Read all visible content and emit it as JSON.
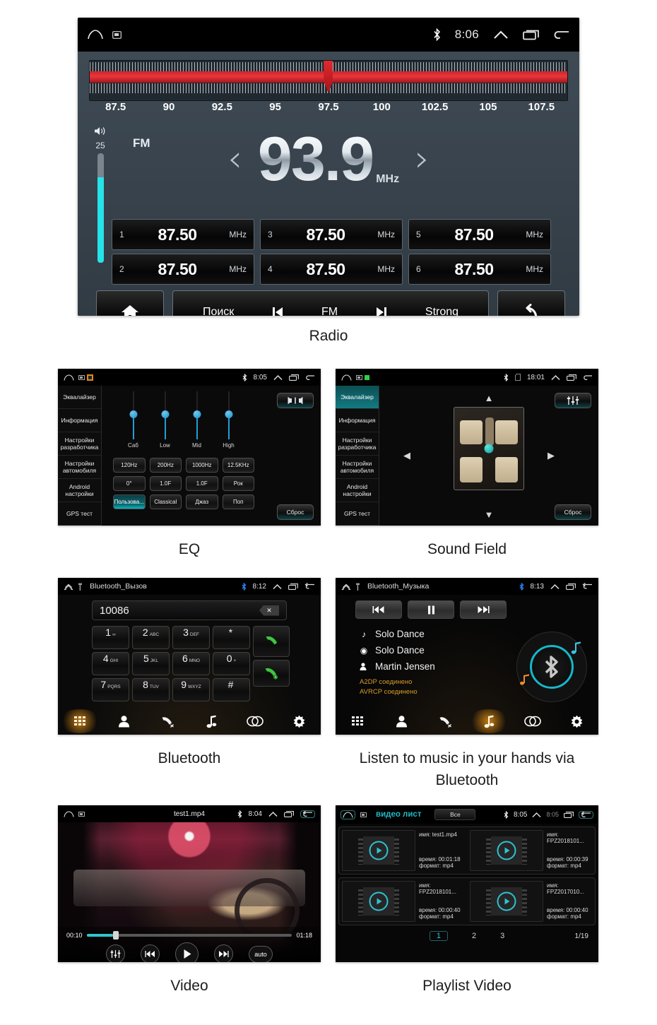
{
  "captions": {
    "radio": "Radio",
    "eq": "EQ",
    "sound_field": "Sound Field",
    "bluetooth": "Bluetooth",
    "bt_music": "Listen to music in your hands via Bluetooth",
    "video": "Video",
    "playlist": "Playlist Video"
  },
  "radio": {
    "statusbar": {
      "time": "8:06",
      "bluetooth_icon": "bluetooth-icon",
      "home_icon": "home-icon",
      "screen_icon": "screen-icon",
      "up_icon": "chevron-up-icon",
      "recents_icon": "recents-icon",
      "back_icon": "back-icon"
    },
    "tuner": {
      "scale_labels": [
        "87.5",
        "90",
        "92.5",
        "95",
        "97.5",
        "100",
        "102.5",
        "105",
        "107.5"
      ],
      "needle_percent": 49,
      "band_color": "#d2252b"
    },
    "volume": {
      "value": "25",
      "level_percent": 78,
      "fill_color": "#25e3e8",
      "icon": "volume-icon"
    },
    "band": "FM",
    "frequency": "93.9",
    "frequency_unit": "MHz",
    "prev_icon": "chevron-left-icon",
    "next_icon": "chevron-right-icon",
    "presets": [
      {
        "index": "1",
        "value": "87.50",
        "unit": "MHz"
      },
      {
        "index": "3",
        "value": "87.50",
        "unit": "MHz"
      },
      {
        "index": "5",
        "value": "87.50",
        "unit": "MHz"
      },
      {
        "index": "2",
        "value": "87.50",
        "unit": "MHz"
      },
      {
        "index": "4",
        "value": "87.50",
        "unit": "MHz"
      },
      {
        "index": "6",
        "value": "87.50",
        "unit": "MHz"
      }
    ],
    "bottom": {
      "home_icon": "home-icon",
      "search_label": "Поиск",
      "prev_icon": "skip-previous-icon",
      "band_label": "FM",
      "next_icon": "skip-next-icon",
      "strong_label": "Strong",
      "back_icon": "back-arrow-icon"
    }
  },
  "eq": {
    "statusbar": {
      "time": "8:05"
    },
    "sidebar": [
      "Эквалайзер",
      "Информация",
      "Настройки разработчика",
      "Настройки автомобиля",
      "Android настройки",
      "GPS тест"
    ],
    "sidebar_active_index": -1,
    "sliders": [
      {
        "label": "Саб",
        "position_percent": 50
      },
      {
        "label": "Low",
        "position_percent": 50
      },
      {
        "label": "Mid",
        "position_percent": 50
      },
      {
        "label": "High",
        "position_percent": 50
      }
    ],
    "buttons_row1": [
      "120Hz",
      "200Hz",
      "1000Hz",
      "12.5KHz"
    ],
    "buttons_row2": [
      "0°",
      "1.0F",
      "1.0F",
      "Рок"
    ],
    "buttons_row3": [
      "Пользова...",
      "Classical",
      "Джаз",
      "Поп"
    ],
    "active_preset": "Пользова...",
    "balance_icon": "speaker-balance-icon",
    "reset_label": "Сброс"
  },
  "sound_field": {
    "statusbar": {
      "time": "18:01"
    },
    "sidebar": [
      "Эквалайзер",
      "Информация",
      "Настройки разработчика",
      "Настройки автомобиля",
      "Android настройки",
      "GPS тест"
    ],
    "sidebar_active_index": 0,
    "eq_icon": "equalizer-sliders-icon",
    "reset_label": "Сброс",
    "arrows": {
      "up": "arrow-up-icon",
      "down": "arrow-down-icon",
      "left": "arrow-left-icon",
      "right": "arrow-right-icon"
    },
    "focus_dot_color": "#0b9c9c"
  },
  "bluetooth": {
    "statusbar": {
      "title": "Bluetooth_Вызов",
      "time": "8:12"
    },
    "dial_number": "10086",
    "backspace_icon": "backspace-icon",
    "keys": [
      {
        "big": "1",
        "sml": "∞"
      },
      {
        "big": "2",
        "sml": "ABC"
      },
      {
        "big": "3",
        "sml": "DEF"
      },
      {
        "big": "*",
        "sml": ""
      },
      {
        "big": "4",
        "sml": "GHI"
      },
      {
        "big": "5",
        "sml": "JKL"
      },
      {
        "big": "6",
        "sml": "MNO"
      },
      {
        "big": "0",
        "sml": "+"
      },
      {
        "big": "7",
        "sml": "PQRS"
      },
      {
        "big": "8",
        "sml": "TUV"
      },
      {
        "big": "9",
        "sml": "WXYZ"
      },
      {
        "big": "#",
        "sml": ""
      }
    ],
    "call_icon": "call-answer-icon",
    "hangup_icon": "call-end-icon",
    "nav": [
      "dialpad-icon",
      "contacts-icon",
      "call-history-icon",
      "music-icon",
      "link-icon",
      "settings-icon"
    ],
    "nav_active_index": 0
  },
  "bt_music": {
    "statusbar": {
      "title": "Bluetooth_Музыка",
      "time": "8:13"
    },
    "controls": [
      "skip-previous-icon",
      "pause-icon",
      "skip-next-icon"
    ],
    "track_title": "Solo Dance",
    "album": "Solo Dance",
    "artist": "Martin Jensen",
    "status_a2dp": "A2DP соединено",
    "status_avrcp": "AVRCP соединено",
    "disc_icon": "bluetooth-disc-icon",
    "nav": [
      "dialpad-icon",
      "contacts-icon",
      "call-history-icon",
      "music-icon",
      "link-icon",
      "settings-icon"
    ],
    "nav_active_index": 3
  },
  "video": {
    "statusbar": {
      "title": "test1.mp4",
      "time": "8:04"
    },
    "current_time": "00:10",
    "total_time": "01:18",
    "progress_percent": 13,
    "controls": [
      "equalizer-icon",
      "skip-previous-icon",
      "play-icon",
      "skip-next-icon"
    ],
    "auto_label": "auto"
  },
  "playlist": {
    "statusbar": {
      "title": "видео лист",
      "filter_label": "Все",
      "time": "8:05",
      "time2": "8:05"
    },
    "items": [
      {
        "name_label": "имя:",
        "name": "test1.mp4",
        "time_label": "время:",
        "time": "00:01:18",
        "format_label": "формат:",
        "format": "mp4"
      },
      {
        "name_label": "имя:",
        "name": "FPZ2018101...",
        "time_label": "время:",
        "time": "00:00:39",
        "format_label": "формат:",
        "format": "mp4"
      },
      {
        "name_label": "имя:",
        "name": "FPZ2018101...",
        "time_label": "время:",
        "time": "00:00:40",
        "format_label": "формат:",
        "format": "mp4"
      },
      {
        "name_label": "имя:",
        "name": "FPZ2017010...",
        "time_label": "время:",
        "time": "00:00:40",
        "format_label": "формат:",
        "format": "mp4"
      }
    ],
    "pages": [
      "1",
      "2",
      "3"
    ],
    "active_page": "1",
    "page_count": "1/19"
  }
}
